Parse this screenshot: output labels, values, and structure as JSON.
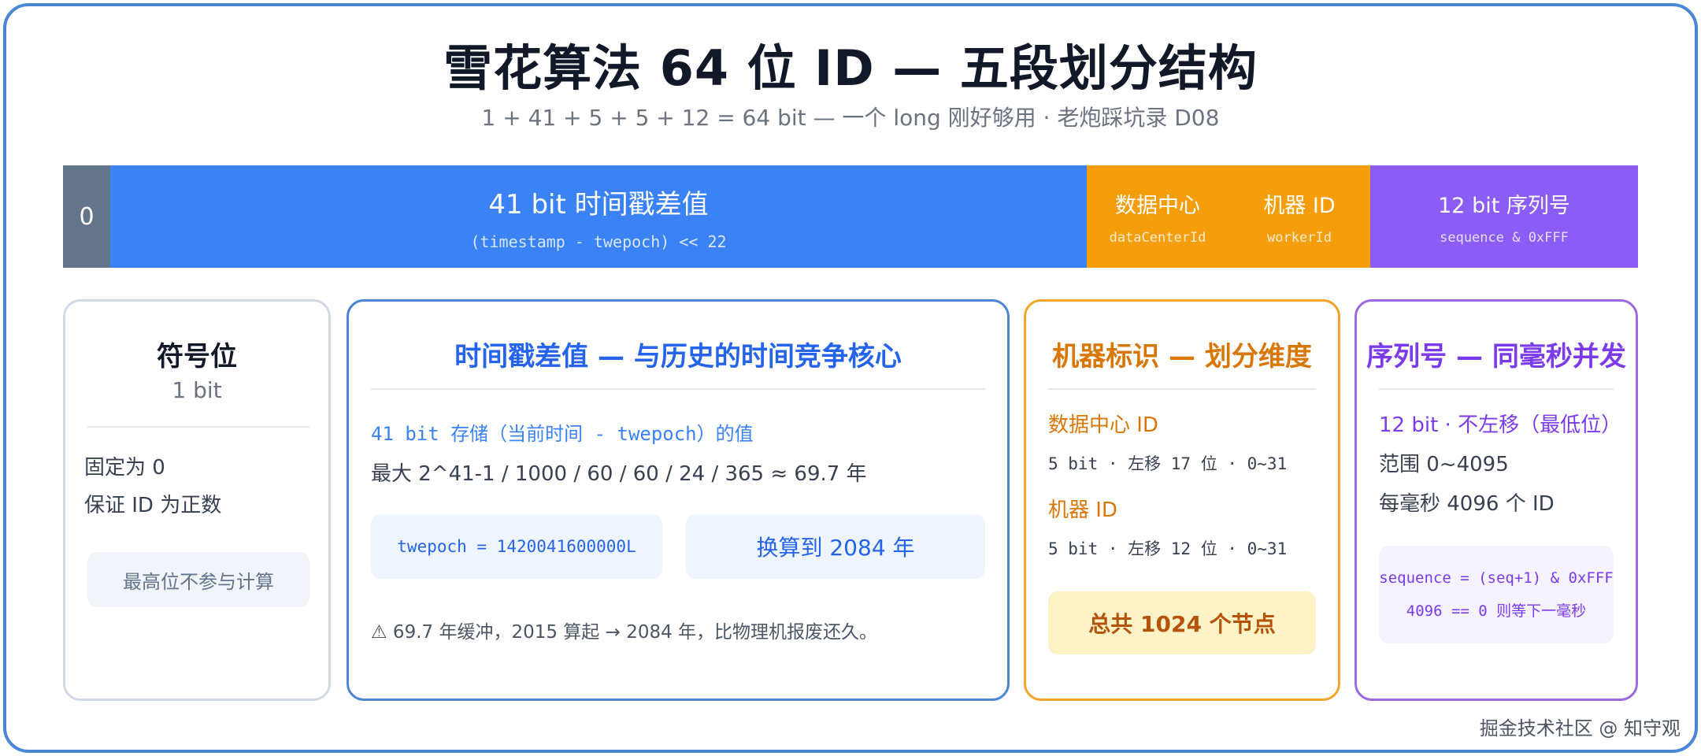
{
  "title": "雪花算法 64 位 ID — 五段划分结构",
  "subtitle": "1 + 41 + 5 + 5 + 12 = 64 bit — 一个 long 刚好够用 · 老炮踩坑录 D08",
  "bitbar": {
    "sign": {
      "label": "0"
    },
    "timestamp": {
      "label": "41 bit 时间戳差值",
      "sub": "(timestamp - twepoch) << 22"
    },
    "datacenter": {
      "label": "数据中心",
      "sub": "dataCenterId"
    },
    "worker": {
      "label": "机器 ID",
      "sub": "workerId"
    },
    "sequence": {
      "label": "12 bit 序列号",
      "sub": "sequence & 0xFFF"
    }
  },
  "cards": {
    "sign": {
      "title": "符号位",
      "bits": "1 bit",
      "line1": "固定为 0",
      "line2": "保证 ID 为正数",
      "note": "最高位不参与计算"
    },
    "timestamp": {
      "title": "时间戳差值 — 与历史的时间竞争核心",
      "line1": "41 bit 存储（当前时间 - twepoch）的值",
      "line2": "最大 2^41-1 / 1000 / 60 / 60 / 24 / 365 ≈ 69.7 年",
      "box1": "twepoch = 1420041600000L",
      "box2": "换算到 2084 年",
      "warning": "⚠ 69.7 年缓冲，2015 算起 → 2084 年，比物理机报废还久。"
    },
    "machine": {
      "title": "机器标识 — 划分维度",
      "dc_label": "数据中心 ID",
      "dc_sub": "5 bit · 左移 17 位 · 0~31",
      "wk_label": "机器 ID",
      "wk_sub": "5 bit · 左移 12 位 · 0~31",
      "total": "总共 1024 个节点"
    },
    "sequence": {
      "title": "序列号 — 同毫秒并发",
      "line1": "12 bit · 不左移（最低位）",
      "line2": "范围 0~4095",
      "line3": "每毫秒 4096 个 ID",
      "code1": "sequence = (seq+1) & 0xFFF",
      "code2": "4096 == 0 则等下一毫秒"
    }
  },
  "watermark": "掘金技术社区 @ 知守观",
  "colors": {
    "sign": "#64748b",
    "timestamp": "#3b82f6",
    "machine": "#f59e0b",
    "sequence": "#8b5cf6",
    "frame": "#4a86d4"
  }
}
